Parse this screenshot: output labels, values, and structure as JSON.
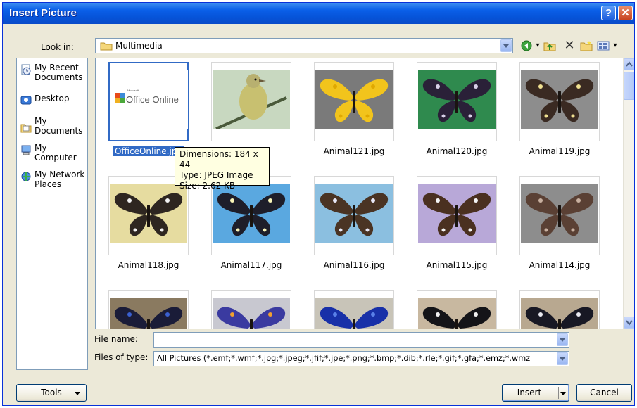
{
  "window": {
    "title": "Insert Picture",
    "help_glyph": "?",
    "close_glyph": "✕"
  },
  "look_in": {
    "label": "Look in:",
    "value": "Multimedia"
  },
  "toolbar": {
    "icons": [
      "back-icon",
      "up-folder-icon",
      "delete-icon",
      "new-folder-icon",
      "views-icon"
    ]
  },
  "places": [
    {
      "label": "My Recent Documents",
      "icon": "recent-documents-icon"
    },
    {
      "label": "Desktop",
      "icon": "desktop-icon"
    },
    {
      "label": "My Documents",
      "icon": "my-documents-icon"
    },
    {
      "label": "My Computer",
      "icon": "my-computer-icon"
    },
    {
      "label": "My Network Places",
      "icon": "network-places-icon"
    }
  ],
  "files": [
    {
      "name": "OfficeOnline.jpg",
      "kind": "logo",
      "logo_text": "Office Online",
      "logo_small": "Microsoft"
    },
    {
      "name": "JPG",
      "kind": "bird"
    },
    {
      "name": "Animal121.jpg",
      "kind": "butterfly",
      "bg": "#7a7a7a",
      "wing": "#f2c41c",
      "spot": "#e0a800"
    },
    {
      "name": "Animal120.jpg",
      "kind": "butterfly",
      "bg": "#2f8a4e",
      "wing": "#2a2038",
      "spot": "#d8d0e8"
    },
    {
      "name": "Animal119.jpg",
      "kind": "butterfly",
      "bg": "#8d8d8d",
      "wing": "#3a2a22",
      "spot": "#f0e090"
    },
    {
      "name": "Animal118.jpg",
      "kind": "butterfly",
      "bg": "#e6dca0",
      "wing": "#2e2620",
      "spot": "#f2f2f2"
    },
    {
      "name": "Animal117.jpg",
      "kind": "butterfly",
      "bg": "#5aa8e0",
      "wing": "#1e1e2a",
      "spot": "#f8f4b8"
    },
    {
      "name": "Animal116.jpg",
      "kind": "butterfly",
      "bg": "#8bbfe0",
      "wing": "#4a3424",
      "spot": "#e8e8f8"
    },
    {
      "name": "Animal115.jpg",
      "kind": "butterfly",
      "bg": "#b8a8d8",
      "wing": "#4a3020",
      "spot": "#f4f4f4"
    },
    {
      "name": "Animal114.jpg",
      "kind": "butterfly",
      "bg": "#8d8d8d",
      "wing": "#5a4034",
      "spot": "#c8b0a0"
    },
    {
      "name": "",
      "kind": "butterfly",
      "bg": "#8a7a60",
      "wing": "#1a1c38",
      "spot": "#3a60d0"
    },
    {
      "name": "",
      "kind": "butterfly",
      "bg": "#c8c8d0",
      "wing": "#3a3aa0",
      "spot": "#f0a030"
    },
    {
      "name": "",
      "kind": "butterfly",
      "bg": "#c8c4b8",
      "wing": "#1830a8",
      "spot": "#5a80e8"
    },
    {
      "name": "",
      "kind": "butterfly",
      "bg": "#c8b8a0",
      "wing": "#141418",
      "spot": "#f0f0f0"
    },
    {
      "name": "",
      "kind": "butterfly",
      "bg": "#b8a890",
      "wing": "#181824",
      "spot": "#e8e8f0"
    }
  ],
  "tooltip": {
    "dimensions": "Dimensions: 184 x 44",
    "type": "Type: JPEG Image",
    "size": "Size: 2.62 KB"
  },
  "file_name": {
    "label": "File name:",
    "value": ""
  },
  "files_of_type": {
    "label": "Files of type:",
    "value": "All Pictures (*.emf;*.wmf;*.jpg;*.jpeg;*.jfif;*.jpe;*.png;*.bmp;*.dib;*.rle;*.gif;*.gfa;*.emz;*.wmz"
  },
  "buttons": {
    "tools": "Tools",
    "insert": "Insert",
    "cancel": "Cancel"
  }
}
